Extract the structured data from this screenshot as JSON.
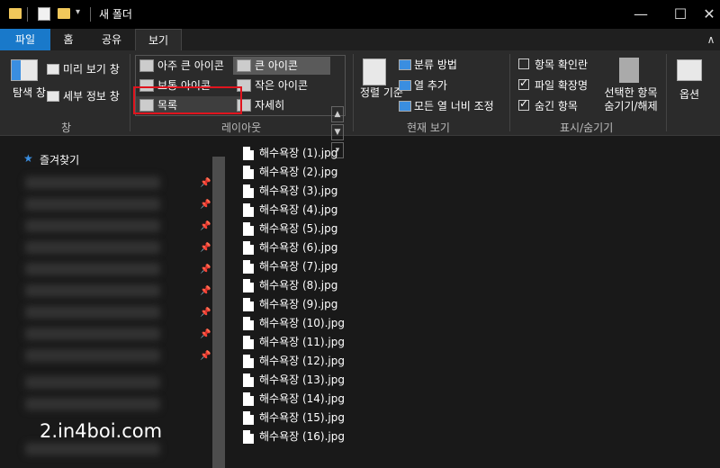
{
  "window": {
    "title": "새 폴더",
    "minimize": "—",
    "maximize": "☐",
    "close": "✕",
    "collapse": "∧"
  },
  "tabs": [
    "파일",
    "홈",
    "공유",
    "보기"
  ],
  "ribbon": {
    "pane": {
      "nav_pane": "탐색 창",
      "preview_pane": "미리 보기 창",
      "details_pane": "세부 정보 창",
      "group": "창"
    },
    "layout": {
      "items": [
        "아주 큰 아이콘",
        "큰 아이콘",
        "보통 아이콘",
        "작은 아이콘",
        "목록",
        "자세히"
      ],
      "group": "레이아웃"
    },
    "current_view": {
      "sort_by": "정렬 기준",
      "group_by": "분류 방법",
      "add_columns": "열 추가",
      "size_columns": "모든 열 너비 조정",
      "group": "현재 보기"
    },
    "show_hide": {
      "item_checkboxes": "항목 확인란",
      "file_extensions": "파일 확장명",
      "hidden_items": "숨긴 항목",
      "hide_selected": "선택한 항목 숨기기/해제",
      "group": "표시/숨기기",
      "checks": [
        false,
        true,
        true
      ]
    },
    "options": "옵션"
  },
  "nav": {
    "favorites": "즐겨찾기"
  },
  "files": [
    "해수욕장 (1).jpg",
    "해수욕장 (2).jpg",
    "해수욕장 (3).jpg",
    "해수욕장 (4).jpg",
    "해수욕장 (5).jpg",
    "해수욕장 (6).jpg",
    "해수욕장 (7).jpg",
    "해수욕장 (8).jpg",
    "해수욕장 (9).jpg",
    "해수욕장 (10).jpg",
    "해수욕장 (11).jpg",
    "해수욕장 (12).jpg",
    "해수욕장 (13).jpg",
    "해수욕장 (14).jpg",
    "해수욕장 (15).jpg",
    "해수욕장 (16).jpg"
  ],
  "watermark": "2.in4boi.com",
  "colors": {
    "accent": "#1979ca",
    "highlight": "#e0141e",
    "folder": "#f1c85b"
  }
}
